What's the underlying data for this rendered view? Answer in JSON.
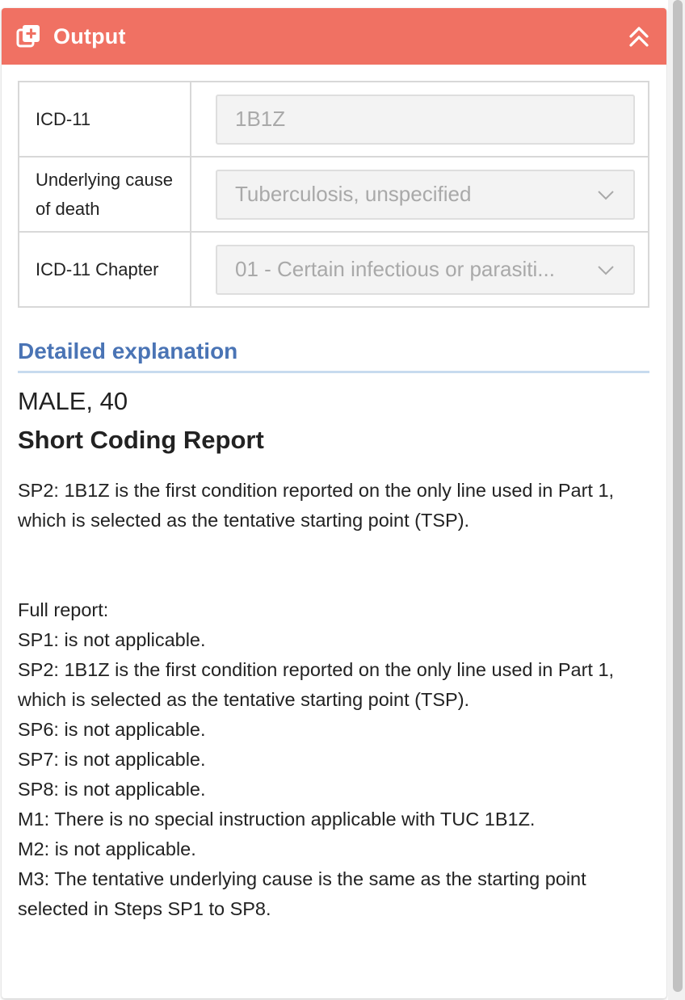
{
  "panel": {
    "title": "Output",
    "header_color": "#f07163",
    "header_icon": "add-to-queue-icon",
    "collapse_icon": "double-chevron-up-icon"
  },
  "form": {
    "rows": [
      {
        "label": "ICD-11",
        "value": "1B1Z",
        "type": "text"
      },
      {
        "label": "Underlying cause of death",
        "value": "Tuberculosis, unspecified",
        "type": "select"
      },
      {
        "label": "ICD-11 Chapter",
        "value": "01 - Certain infectious or parasiti...",
        "type": "select"
      }
    ]
  },
  "explanation": {
    "section_title": "Detailed explanation",
    "patient": "MALE, 40",
    "report_title": "Short Coding Report",
    "short_report": "SP2: 1B1Z is the first condition reported on the only line used in Part 1, which is selected as the tentative starting point (TSP).",
    "full_report_heading": "Full report:",
    "full_report_lines": [
      "SP1: is not applicable.",
      "SP2: 1B1Z is the first condition reported on the only line used in Part 1, which is selected as the tentative starting point (TSP).",
      "SP6: is not applicable.",
      "SP7: is not applicable.",
      "SP8: is not applicable.",
      "M1: There is no special instruction applicable with TUC 1B1Z.",
      "M2: is not applicable.",
      "M3: The tentative underlying cause is the same as the starting point selected in Steps SP1 to SP8."
    ]
  }
}
